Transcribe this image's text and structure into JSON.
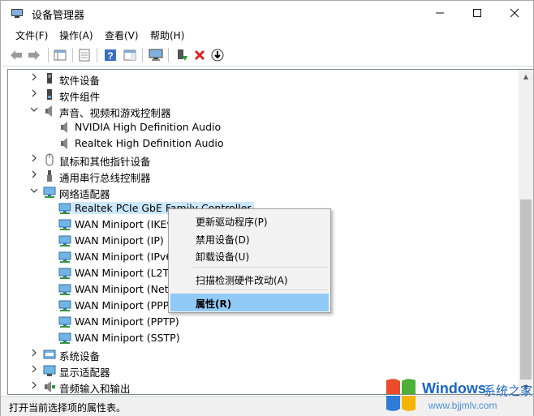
{
  "window": {
    "title": "设备管理器"
  },
  "menu": [
    "文件(F)",
    "操作(A)",
    "查看(V)",
    "帮助(H)"
  ],
  "toolbar_icons": [
    "back-arrow-icon",
    "forward-arrow-icon",
    "properties-grid-icon",
    "document-icon",
    "help-icon",
    "panel-icon",
    "monitor-icon",
    "enable-device-icon",
    "remove-x-icon",
    "download-icon"
  ],
  "tree": {
    "rows": [
      {
        "label": "软件设备",
        "expand": ">",
        "icon": "software-device-icon"
      },
      {
        "label": "软件组件",
        "expand": ">",
        "icon": "software-component-icon"
      },
      {
        "label": "声音、视频和游戏控制器",
        "expand": "v",
        "icon": "speaker-icon"
      },
      {
        "label": "NVIDIA High Definition Audio",
        "expand": "",
        "icon": "speaker-icon"
      },
      {
        "label": "Realtek High Definition Audio",
        "expand": "",
        "icon": "speaker-icon"
      },
      {
        "label": "鼠标和其他指针设备",
        "expand": ">",
        "icon": "mouse-icon"
      },
      {
        "label": "通用串行总线控制器",
        "expand": ">",
        "icon": "usb-icon"
      },
      {
        "label": "网络适配器",
        "expand": "v",
        "icon": "network-adapter-icon"
      },
      {
        "label": "Realtek PCIe GbE Family Controller",
        "expand": "",
        "icon": "network-adapter-icon"
      },
      {
        "label": "WAN Miniport (IKEv2)",
        "expand": "",
        "icon": "network-adapter-icon"
      },
      {
        "label": "WAN Miniport (IP)",
        "expand": "",
        "icon": "network-adapter-icon"
      },
      {
        "label": "WAN Miniport (IPv6)",
        "expand": "",
        "icon": "network-adapter-icon"
      },
      {
        "label": "WAN Miniport (L2TP)",
        "expand": "",
        "icon": "network-adapter-icon"
      },
      {
        "label": "WAN Miniport (Network Monitor)",
        "expand": "",
        "icon": "network-adapter-icon"
      },
      {
        "label": "WAN Miniport (PPPOE)",
        "expand": "",
        "icon": "network-adapter-icon"
      },
      {
        "label": "WAN Miniport (PPTP)",
        "expand": "",
        "icon": "network-adapter-icon"
      },
      {
        "label": "WAN Miniport (SSTP)",
        "expand": "",
        "icon": "network-adapter-icon"
      },
      {
        "label": "系统设备",
        "expand": ">",
        "icon": "system-device-icon"
      },
      {
        "label": "显示适配器",
        "expand": ">",
        "icon": "display-adapter-icon"
      },
      {
        "label": "音频输入和输出",
        "expand": ">",
        "icon": "audio-io-icon"
      }
    ]
  },
  "context_menu": {
    "items": [
      "更新驱动程序(P)",
      "禁用设备(D)",
      "卸载设备(U)",
      "扫描检测硬件改动(A)",
      "属性(R)"
    ]
  },
  "status": {
    "text": "打开当前选择项的属性表。"
  },
  "watermark": {
    "brand": "Windows",
    "brand_cn": "系统之家",
    "url": "www.bjjmlv.com"
  },
  "colors": {
    "selection": "#cce8ff",
    "menu_highlight": "#91c9f7",
    "watermark_blue": "#1a66c4"
  }
}
